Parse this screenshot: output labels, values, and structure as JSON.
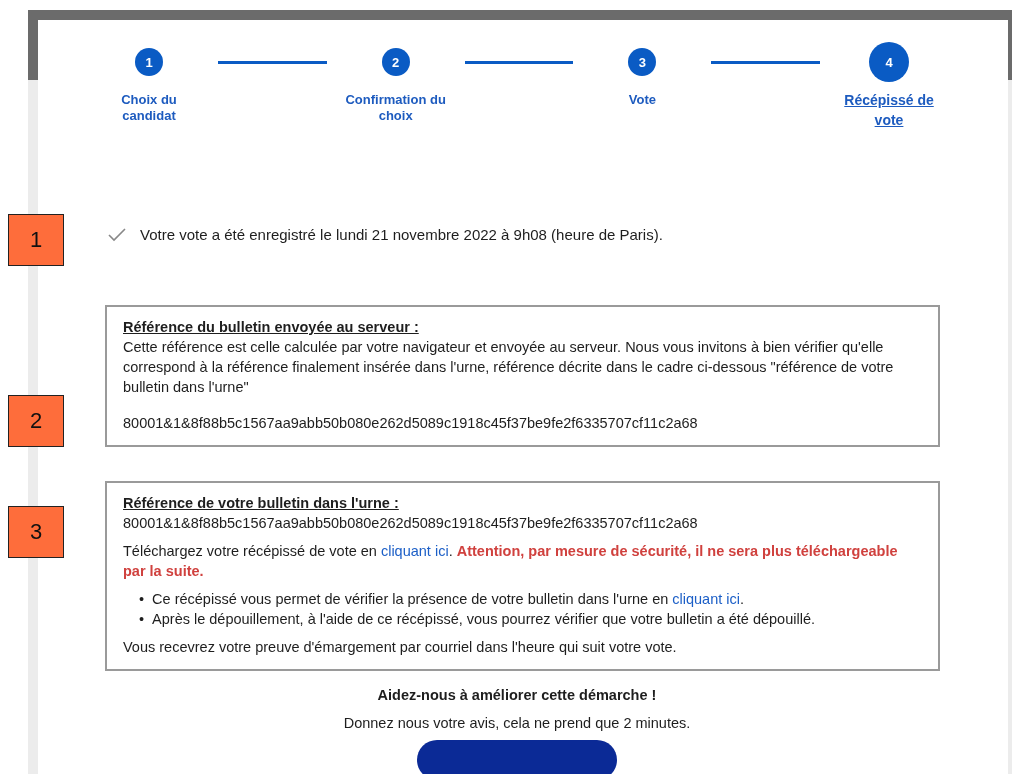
{
  "steps": [
    {
      "number": "1",
      "label": "Choix du candidat",
      "selected": false
    },
    {
      "number": "2",
      "label": "Confirmation du choix",
      "selected": false
    },
    {
      "number": "3",
      "label": "Vote",
      "selected": false
    },
    {
      "number": "4",
      "label": "Récépissé de vote",
      "selected": true
    }
  ],
  "confirmation": {
    "text": "Votre vote a été enregistré le lundi 21 novembre 2022 à 9h08 (heure de Paris)."
  },
  "server_reference": {
    "title": "Référence du bulletin envoyée au serveur :",
    "description": "Cette référence est celle calculée par votre navigateur et envoyée au serveur. Nous vous invitons à bien vérifier qu'elle correspond à la référence finalement insérée dans l'urne, référence décrite dans le cadre ci-dessous \"référence de votre bulletin dans l'urne\"",
    "reference": "80001&1&8f88b5c1567aa9abb50b080e262d5089c1918c45f37be9fe2f6335707cf11c2a68"
  },
  "urn_reference": {
    "title": "Référence de votre bulletin dans l'urne :",
    "reference": "80001&1&8f88b5c1567aa9abb50b080e262d5089c1918c45f37be9fe2f6335707cf11c2a68",
    "download": {
      "before": "Téléchargez votre récépissé de vote en ",
      "link": "cliquant ici",
      "after": ". ",
      "warning": "Attention, par mesure de sécurité, il ne sera plus téléchargeable par la suite."
    },
    "bullets": [
      {
        "marker": "•",
        "text": "Ce récépissé vous permet de vérifier la présence de votre bulletin dans l'urne en ",
        "link": "cliquant ici",
        "after": "."
      },
      {
        "marker": "•",
        "text": "Après le dépouillement, à l'aide de ce récépissé, vous pourrez vérifier que votre bulletin a été dépouillé."
      }
    ],
    "note": "Vous recevrez votre preuve d'émargement par courriel dans l'heure qui suit votre vote."
  },
  "feedback": {
    "title": "Aidez-nous à améliorer cette démarche !",
    "subtitle": "Donnez nous votre avis, cela ne prend que 2 minutes."
  },
  "callouts": [
    "1",
    "2",
    "3"
  ]
}
